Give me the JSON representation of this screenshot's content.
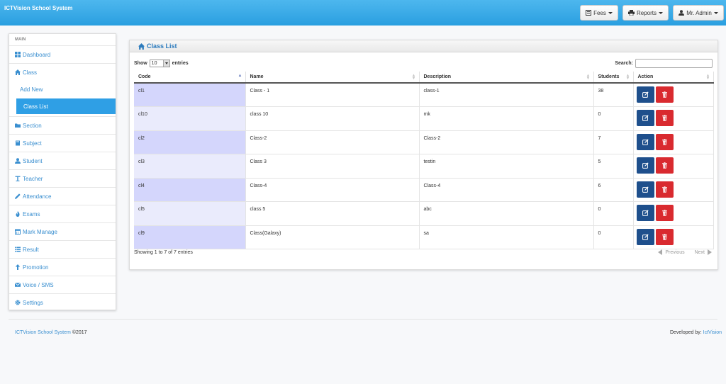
{
  "app": {
    "title": "ICTVision School System"
  },
  "topbar": {
    "fees_label": "Fees",
    "reports_label": "Reports",
    "user_label": "Mr. Admin"
  },
  "sidebar": {
    "heading": "MAIN",
    "items": [
      {
        "label": "Dashboard",
        "icon": "dashboard-icon"
      },
      {
        "label": "Class",
        "icon": "home-icon"
      },
      {
        "label": "Section",
        "icon": "folder-icon"
      },
      {
        "label": "Subject",
        "icon": "book-icon"
      },
      {
        "label": "Student",
        "icon": "user-icon"
      },
      {
        "label": "Teacher",
        "icon": "text-height-icon"
      },
      {
        "label": "Attendance",
        "icon": "pencil-icon"
      },
      {
        "label": "Exams",
        "icon": "fire-icon"
      },
      {
        "label": "Mark Manage",
        "icon": "calendar-icon"
      },
      {
        "label": "Result",
        "icon": "list-icon"
      },
      {
        "label": "Promotion",
        "icon": "arrow-up-icon"
      },
      {
        "label": "Voice / SMS",
        "icon": "envelope-icon"
      },
      {
        "label": "Settings",
        "icon": "gear-icon"
      }
    ],
    "class_sub": {
      "add_new": "Add New",
      "class_list": "Class List"
    }
  },
  "panel": {
    "title": "Class List",
    "show_label": "Show",
    "entries_label": "entries",
    "page_size": "10",
    "search_label": "Search:",
    "columns": [
      "Code",
      "Name",
      "Description",
      "Students",
      "Action"
    ],
    "rows": [
      {
        "code": "cl1",
        "name": "Class - 1",
        "description": "class-1",
        "students": "38"
      },
      {
        "code": "cl10",
        "name": "class 10",
        "description": "mk",
        "students": "0"
      },
      {
        "code": "cl2",
        "name": "Class-2",
        "description": "Class-2",
        "students": "7"
      },
      {
        "code": "cl3",
        "name": "Class 3",
        "description": "testin",
        "students": "5"
      },
      {
        "code": "cl4",
        "name": "Class-4",
        "description": "Class-4",
        "students": "6"
      },
      {
        "code": "cl5",
        "name": "class 5",
        "description": "abc",
        "students": "0"
      },
      {
        "code": "cl9",
        "name": "Class(Galaxy)",
        "description": "sa",
        "students": "0"
      }
    ],
    "info": "Showing 1 to 7 of 7 entries",
    "previous_label": "Previous",
    "next_label": "Next"
  },
  "footer": {
    "brand": "ICTVision School System",
    "copyright": "©2017",
    "developed_by": "Developed by:",
    "developer": "IctVision"
  },
  "colors": {
    "topbar": "#2a9fe0",
    "accent": "#3a8fd0",
    "edit_button": "#1e4f8c",
    "delete_button": "#d92a2f"
  }
}
